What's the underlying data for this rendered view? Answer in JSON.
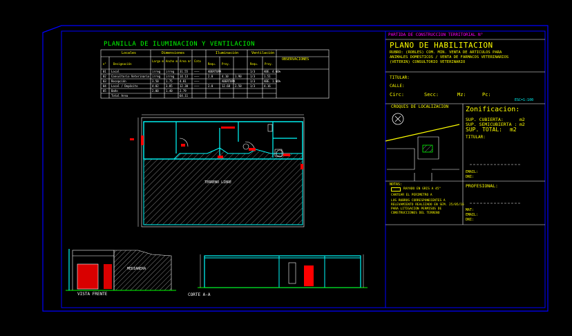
{
  "colors": {
    "background": "#000000",
    "frame": "#0000ff",
    "title_text": "#ffff00",
    "heading_text": "#00ffff",
    "accent": "#ff00ff",
    "walls": "#00ffff",
    "fixtures": "#ff0000"
  },
  "illumination_table": {
    "title": "PLANILLA DE ILUMINACION Y VENTILACION",
    "headers": {
      "locales": "Locales",
      "dimensiones": "Dimensiones",
      "iluminacion": "Iluminación",
      "ventilacion": "Ventilación",
      "observaciones": "OBSERVACIONES",
      "n": "n°",
      "designacion": "Designación",
      "largo": "Largo m",
      "ancho": "Ancho m",
      "area": "Area m²",
      "cota": "Cota",
      "requerido": "Requ.",
      "proyecto": "Proy.",
      "req2": "Requ.",
      "proy2": "Proy."
    },
    "rows": [
      {
        "n": "01",
        "name": "Local",
        "largo": "irreg",
        "ancho": "irreg",
        "area": "31.55",
        "cota": "———",
        "a": "ABERTURA",
        "b": "",
        "c": "",
        "d": "1/3",
        "e": "ABE. 4.66%"
      },
      {
        "n": "02",
        "name": "Consultorio Veterinario",
        "largo": "irreg",
        "ancho": "irreg",
        "area": "14.13",
        "cota": "———",
        "a": "2.0",
        "b": "4.10",
        "c": "1.90",
        "d": "1/3",
        "e": "1.51"
      },
      {
        "n": "03",
        "name": "Recepción",
        "largo": "3.50",
        "ancho": "1.75",
        "area": "4.01",
        "cota": "———",
        "a": "",
        "b": "ABERTURA",
        "c": "",
        "d": "1/3",
        "e": "ABE. 1.66%"
      },
      {
        "n": "04",
        "name": "Local / Depósito",
        "largo": "4.02",
        "ancho": "3.05",
        "area": "12.30",
        "cota": "———",
        "a": "2.0",
        "b": "12.68",
        "c": "2.50",
        "d": "1/3",
        "e": "4.16"
      },
      {
        "n": "05",
        "name": "Baño",
        "largo": "2.00",
        "ancho": "1.40",
        "area": "2.79",
        "cota": "",
        "a": "",
        "b": "",
        "c": "",
        "d": "",
        "e": ""
      },
      {
        "n": "",
        "name": "Total Area",
        "largo": "",
        "ancho": "",
        "area": "64.11",
        "cota": "",
        "a": "",
        "b": "",
        "c": "",
        "d": "",
        "e": ""
      }
    ]
  },
  "plan": {
    "terrain_label": "TERRENO LIBRE"
  },
  "drawings": {
    "front_label": "VISTA FRENTE",
    "section_label": "CORTE A-A",
    "neighbor_label": "MEDIANERA"
  },
  "title_block": {
    "header": "PARTIDA DE CONSTRUCCION TERRITORIAL N°",
    "plan_title": "PLANO DE HABILITACION",
    "rubro": "RUBRO: (ROBLES) COM. MIN. VENTA DE ARTICULOS PARA ANIMALES DOMESTICOS / VENTA DE FARMACOS VETERINARIOS (VETERIN) CONSULTORIO VETERINARIO",
    "rubro_lines": [
      "RUBRO: (ROBLES) COM. MIN. VENTA DE ARTICULOS PARA",
      "ANIMALES DOMESTICOS / VENTA DE FARMACOS VETERINARIOS",
      "(VETERIN) CONSULTORIO VETERINARIO"
    ],
    "titular_label": "TITULAR:",
    "calle_label": "CALLE:",
    "circ": "Circ:",
    "secc": "Secc:",
    "mz": "Mz:",
    "pc": "Pc:",
    "scale": "ESC=1:100",
    "location_heading": "CROQUIS DE LOCALIZACION",
    "zonification": "Zonificacion:",
    "sup_cubierta": "SUP. CUBIERTA:",
    "sup_cubierta_unit": "m2",
    "sup_semicubierta": "SUP. SEMICUBIERTA :",
    "sup_semicubierta_unit": "m2",
    "sup_total": "SUP. TOTAL:",
    "sup_total_unit": "m2",
    "titular2": "TITULAR:",
    "email1": "EMAIL:",
    "dni1": "DNI:",
    "profesional": "PROFESIONAL:",
    "mat": "MAT:",
    "email2": "EMAIL:",
    "dni2": "DNI:",
    "notes_heading": "NOTAS:",
    "note1": "RAYADO EN GRIS A 45°",
    "note2": "CANTEAR EL PERIMETRO A",
    "note3_lines": [
      "LOS RUBROS CORRESPONDIENTES A",
      "RELEVAMIENTO REALIZADO EN SEM. 25/05/16",
      "PARA LITIGACION PERMISOS DE",
      "CONSTRUCCIONES DEL TERRENO"
    ]
  }
}
